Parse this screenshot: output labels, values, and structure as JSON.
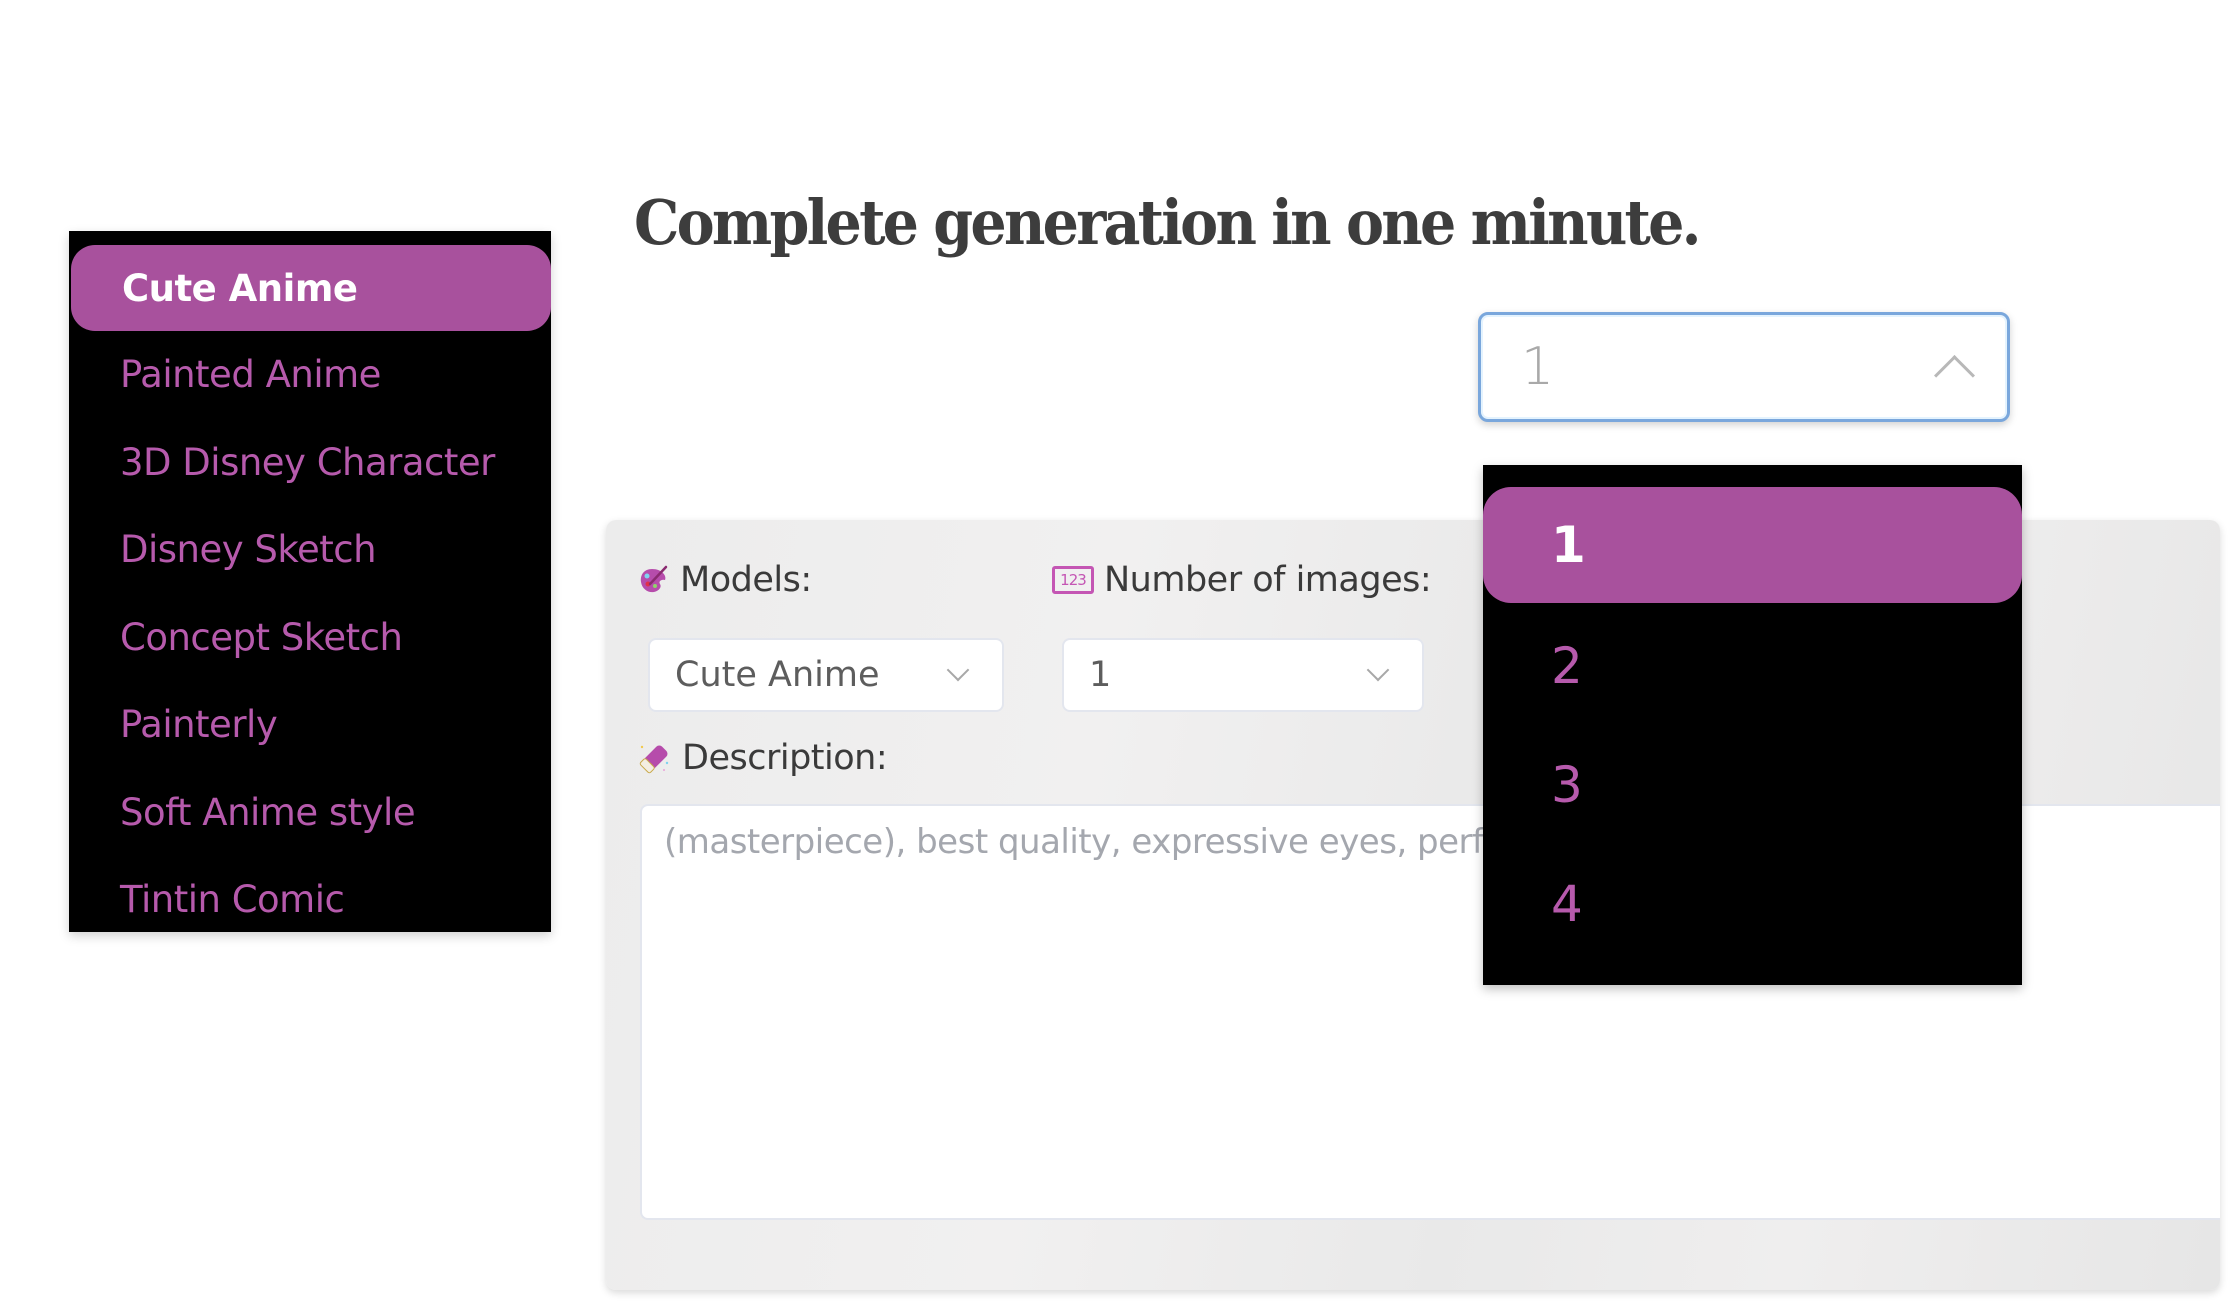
{
  "headline": "Complete generation in one minute.",
  "accent_color": "#a8519d",
  "style_list": {
    "selected_index": 0,
    "items": [
      {
        "label": "Cute Anime"
      },
      {
        "label": "Painted Anime"
      },
      {
        "label": "3D Disney Character"
      },
      {
        "label": "Disney Sketch"
      },
      {
        "label": "Concept Sketch"
      },
      {
        "label": "Painterly"
      },
      {
        "label": "Soft Anime style"
      },
      {
        "label": "Tintin Comic"
      }
    ]
  },
  "number_select_focused": {
    "value": "1",
    "icon": "chevron-up-icon"
  },
  "number_dropdown": {
    "selected_index": 0,
    "options": [
      {
        "label": "1"
      },
      {
        "label": "2"
      },
      {
        "label": "3"
      },
      {
        "label": "4"
      }
    ]
  },
  "form": {
    "models": {
      "label": "Models:",
      "icon": "palette-icon",
      "value": "Cute Anime"
    },
    "number_of_images": {
      "label": "Number of images:",
      "icon": "numbers-123-icon",
      "icon_text": "123",
      "value": "1"
    },
    "description": {
      "label": "Description:",
      "icon": "eraser-icon",
      "placeholder": "(masterpiece), best quality, expressive eyes, perfect face"
    }
  }
}
